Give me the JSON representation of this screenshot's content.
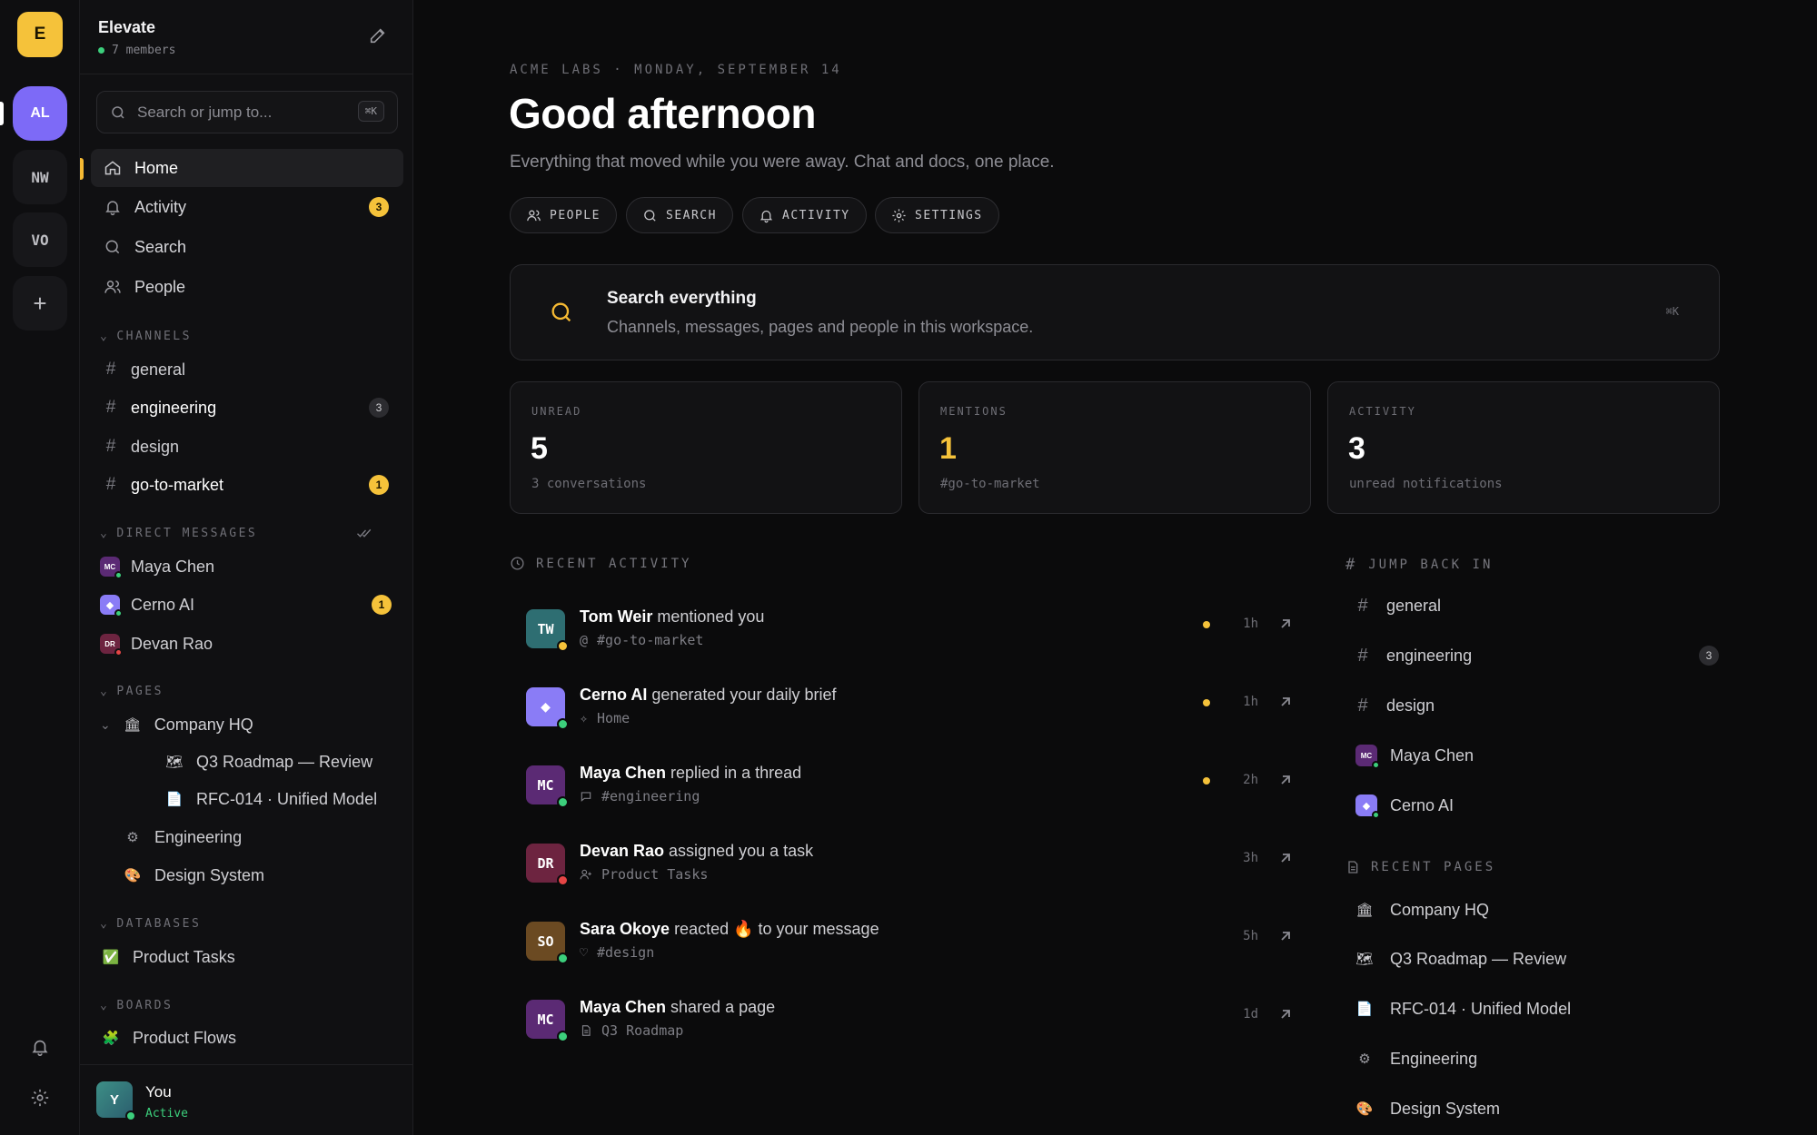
{
  "rail": {
    "workspaces": [
      {
        "initials": "E"
      },
      {
        "initials": "AL"
      },
      {
        "initials": "NW"
      },
      {
        "initials": "VO"
      }
    ],
    "add_label": "+"
  },
  "sidebar": {
    "workspace_name": "Elevate",
    "members": "7 members",
    "search_placeholder": "Search or jump to...",
    "search_shortcut": "⌘K",
    "nav": [
      {
        "label": "Home",
        "icon": "home-icon"
      },
      {
        "label": "Activity",
        "icon": "bell-icon",
        "badge": "3"
      },
      {
        "label": "Search",
        "icon": "search-icon"
      },
      {
        "label": "People",
        "icon": "people-icon"
      }
    ],
    "channels_heading": "CHANNELS",
    "channels": [
      {
        "name": "general"
      },
      {
        "name": "engineering",
        "badge": "3"
      },
      {
        "name": "design"
      },
      {
        "name": "go-to-market",
        "badge": "1"
      }
    ],
    "dm_heading": "DIRECT MESSAGES",
    "dms": [
      {
        "name": "Maya Chen",
        "initials": "MC",
        "color": "#5b2a74",
        "status": "#3ccf7c"
      },
      {
        "name": "Cerno AI",
        "initials": "◆",
        "color": "#8a7cf6",
        "status": "#3ccf7c",
        "badge": "1"
      },
      {
        "name": "Devan Rao",
        "initials": "DR",
        "color": "#6d2440",
        "status": "#e54545"
      }
    ],
    "pages_heading": "PAGES",
    "pages": [
      {
        "label": "Company HQ",
        "icon": "🏛"
      },
      {
        "label": "Q3 Roadmap — Review",
        "icon": "🗺"
      },
      {
        "label": "RFC-014 · Unified Model",
        "icon": "📄"
      },
      {
        "label": "Engineering",
        "icon": "⚙"
      },
      {
        "label": "Design System",
        "icon": "🎨"
      }
    ],
    "databases_heading": "DATABASES",
    "databases": [
      {
        "label": "Product Tasks",
        "icon": "✅"
      }
    ],
    "boards_heading": "BOARDS",
    "boards": [
      {
        "label": "Product Flows",
        "icon": "🧩"
      }
    ],
    "user": {
      "initial": "Y",
      "name": "You",
      "status": "Active"
    }
  },
  "main": {
    "breadcrumb": "ACME LABS · MONDAY, SEPTEMBER 14",
    "greeting": "Good afternoon",
    "subtitle": "Everything that moved while you were away. Chat and docs, one place.",
    "chips": [
      "PEOPLE",
      "SEARCH",
      "ACTIVITY",
      "SETTINGS"
    ],
    "search_card": {
      "title": "Search everything",
      "subtitle": "Channels, messages, pages and people in this workspace.",
      "shortcut": "⌘K"
    },
    "stats": [
      {
        "label": "UNREAD",
        "value": "5",
        "sub": "3 conversations",
        "color": "#ffffff"
      },
      {
        "label": "MENTIONS",
        "value": "1",
        "sub": "#go-to-market",
        "color": "#f5c23a"
      },
      {
        "label": "ACTIVITY",
        "value": "3",
        "sub": "unread notifications",
        "color": "#ffffff"
      }
    ],
    "recent_heading": "RECENT ACTIVITY",
    "activity": [
      {
        "initials": "TW",
        "color": "#2e6e72",
        "status": "#f5c23a",
        "who": "Tom Weir",
        "what": " mentioned you",
        "sub": "#go-to-market",
        "sub_icon": "at-icon",
        "time": "1h",
        "unread": true
      },
      {
        "initials": "◆",
        "color": "#8a7cf6",
        "status": "#3ccf7c",
        "who": "Cerno AI",
        "what": " generated your daily brief",
        "sub": "Home",
        "sub_icon": "sparkle-icon",
        "time": "1h",
        "unread": true
      },
      {
        "initials": "MC",
        "color": "#5b2a74",
        "status": "#3ccf7c",
        "who": "Maya Chen",
        "what": " replied in a thread",
        "sub": "#engineering",
        "sub_icon": "thread-icon",
        "time": "2h",
        "unread": true
      },
      {
        "initials": "DR",
        "color": "#6d2440",
        "status": "#e54545",
        "who": "Devan Rao",
        "what": " assigned you a task",
        "sub": "Product Tasks",
        "sub_icon": "user-plus-icon",
        "time": "3h",
        "unread": false
      },
      {
        "initials": "SO",
        "color": "#6b4a22",
        "status": "#3ccf7c",
        "who": "Sara Okoye",
        "what": " reacted 🔥 to your message",
        "sub": "#design",
        "sub_icon": "heart-icon",
        "time": "5h",
        "unread": false
      },
      {
        "initials": "MC",
        "color": "#5b2a74",
        "status": "#3ccf7c",
        "who": "Maya Chen",
        "what": " shared a page",
        "sub": "Q3 Roadmap",
        "sub_icon": "page-icon",
        "time": "1d",
        "unread": false
      }
    ],
    "jump_heading": "JUMP BACK IN",
    "jump": [
      {
        "type": "channel",
        "label": "general"
      },
      {
        "type": "channel",
        "label": "engineering",
        "badge": "3"
      },
      {
        "type": "channel",
        "label": "design"
      },
      {
        "type": "dm",
        "label": "Maya Chen",
        "initials": "MC",
        "color": "#5b2a74"
      },
      {
        "type": "dm",
        "label": "Cerno AI",
        "initials": "◆",
        "color": "#8a7cf6"
      }
    ],
    "recent_pages_heading": "RECENT PAGES",
    "recent_pages": [
      {
        "label": "Company HQ",
        "icon": "🏛"
      },
      {
        "label": "Q3 Roadmap — Review",
        "icon": "🗺"
      },
      {
        "label": "RFC-014 · Unified Model",
        "icon": "📄"
      },
      {
        "label": "Engineering",
        "icon": "⚙"
      },
      {
        "label": "Design System",
        "icon": "🎨"
      }
    ]
  }
}
